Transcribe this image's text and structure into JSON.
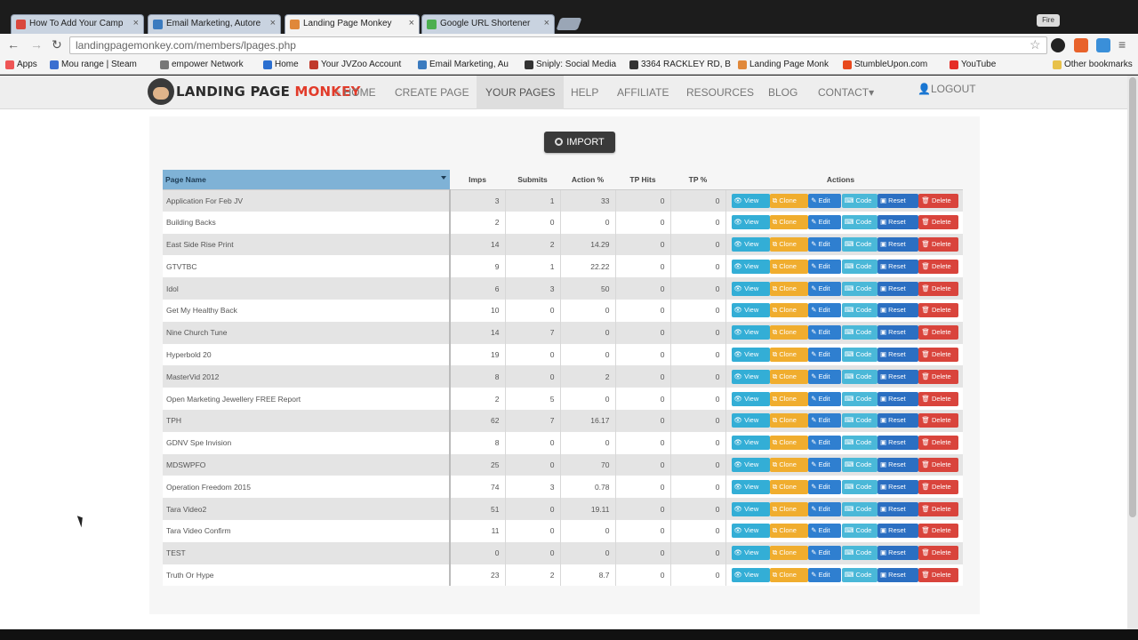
{
  "browser": {
    "tabs": [
      {
        "title": "How To Add Your Camp",
        "color": "#d9463c"
      },
      {
        "title": "Email Marketing, Autore",
        "color": "#3b7bbf"
      },
      {
        "title": "Landing Page Monkey",
        "color": "#e0883a"
      },
      {
        "title": "Google URL Shortener",
        "color": "#4caf50"
      }
    ],
    "window_label": "Fire",
    "url": "landingpagemonkey.com/members/lpages.php",
    "bookmarks": [
      {
        "label": "Apps",
        "color": "#e55"
      },
      {
        "label": "Mou range | Steam",
        "color": "#3b6fd0"
      },
      {
        "label": "empower Network",
        "color": "#777"
      },
      {
        "label": "Home",
        "color": "#2b6fd0"
      },
      {
        "label": "Your JVZoo Account",
        "color": "#c0392b"
      },
      {
        "label": "Email Marketing, Au",
        "color": "#3b7bbf"
      },
      {
        "label": "Sniply: Social Media",
        "color": "#333"
      },
      {
        "label": "3364 RACKLEY RD, B",
        "color": "#333"
      },
      {
        "label": "Landing Page Monk",
        "color": "#e0883a"
      },
      {
        "label": "StumbleUpon.com",
        "color": "#e8491d"
      },
      {
        "label": "YouTube",
        "color": "#e52d27"
      }
    ],
    "other_bookmarks": "Other bookmarks"
  },
  "site": {
    "logo_part1": "LANDING PAGE",
    "logo_part2": "MONKEY",
    "nav": {
      "home": "HOME",
      "create": "CREATE PAGE",
      "your_pages": "YOUR PAGES",
      "help": "HELP",
      "affiliate": "AFFILIATE",
      "resources": "RESOURCES",
      "blog": "BLOG",
      "contact": "CONTACT",
      "logout": "LOGOUT"
    },
    "import_label": "IMPORT"
  },
  "table": {
    "headers": {
      "name": "Page Name",
      "imps": "Imps",
      "submits": "Submits",
      "action_pct": "Action %",
      "tp_hits": "TP Hits",
      "tp_pct": "TP %",
      "actions": "Actions"
    },
    "buttons": {
      "view": "View",
      "clone": "Clone",
      "edit": "Edit",
      "code": "Code",
      "reset": "Reset",
      "delete": "Delete"
    },
    "rows": [
      {
        "name": "Application For Feb JV",
        "imps": "3",
        "submits": "1",
        "action": "33",
        "tp_hits": "0",
        "tp_pct": "0"
      },
      {
        "name": "Building Backs",
        "imps": "2",
        "submits": "0",
        "action": "0",
        "tp_hits": "0",
        "tp_pct": "0"
      },
      {
        "name": "East Side Rise Print",
        "imps": "14",
        "submits": "2",
        "action": "14.29",
        "tp_hits": "0",
        "tp_pct": "0"
      },
      {
        "name": "GTVTBC",
        "imps": "9",
        "submits": "1",
        "action": "22.22",
        "tp_hits": "0",
        "tp_pct": "0"
      },
      {
        "name": "Idol",
        "imps": "6",
        "submits": "3",
        "action": "50",
        "tp_hits": "0",
        "tp_pct": "0"
      },
      {
        "name": "Get My Healthy Back",
        "imps": "10",
        "submits": "0",
        "action": "0",
        "tp_hits": "0",
        "tp_pct": "0"
      },
      {
        "name": "Nine Church Tune",
        "imps": "14",
        "submits": "7",
        "action": "0",
        "tp_hits": "0",
        "tp_pct": "0"
      },
      {
        "name": "Hyperbold 20",
        "imps": "19",
        "submits": "0",
        "action": "0",
        "tp_hits": "0",
        "tp_pct": "0"
      },
      {
        "name": "MasterVid 2012",
        "imps": "8",
        "submits": "0",
        "action": "2",
        "tp_hits": "0",
        "tp_pct": "0"
      },
      {
        "name": "Open Marketing Jewellery FREE Report",
        "imps": "2",
        "submits": "5",
        "action": "0",
        "tp_hits": "0",
        "tp_pct": "0"
      },
      {
        "name": "TPH",
        "imps": "62",
        "submits": "7",
        "action": "16.17",
        "tp_hits": "0",
        "tp_pct": "0"
      },
      {
        "name": "GDNV Spe Invision",
        "imps": "8",
        "submits": "0",
        "action": "0",
        "tp_hits": "0",
        "tp_pct": "0"
      },
      {
        "name": "MDSWPFO",
        "imps": "25",
        "submits": "0",
        "action": "70",
        "tp_hits": "0",
        "tp_pct": "0"
      },
      {
        "name": "Operation Freedom 2015",
        "imps": "74",
        "submits": "3",
        "action": "0.78",
        "tp_hits": "0",
        "tp_pct": "0"
      },
      {
        "name": "Tara Video2",
        "imps": "51",
        "submits": "0",
        "action": "19.11",
        "tp_hits": "0",
        "tp_pct": "0"
      },
      {
        "name": "Tara Video Confirm",
        "imps": "11",
        "submits": "0",
        "action": "0",
        "tp_hits": "0",
        "tp_pct": "0"
      },
      {
        "name": "TEST",
        "imps": "0",
        "submits": "0",
        "action": "0",
        "tp_hits": "0",
        "tp_pct": "0"
      },
      {
        "name": "Truth Or Hype",
        "imps": "23",
        "submits": "2",
        "action": "8.7",
        "tp_hits": "0",
        "tp_pct": "0"
      }
    ]
  }
}
